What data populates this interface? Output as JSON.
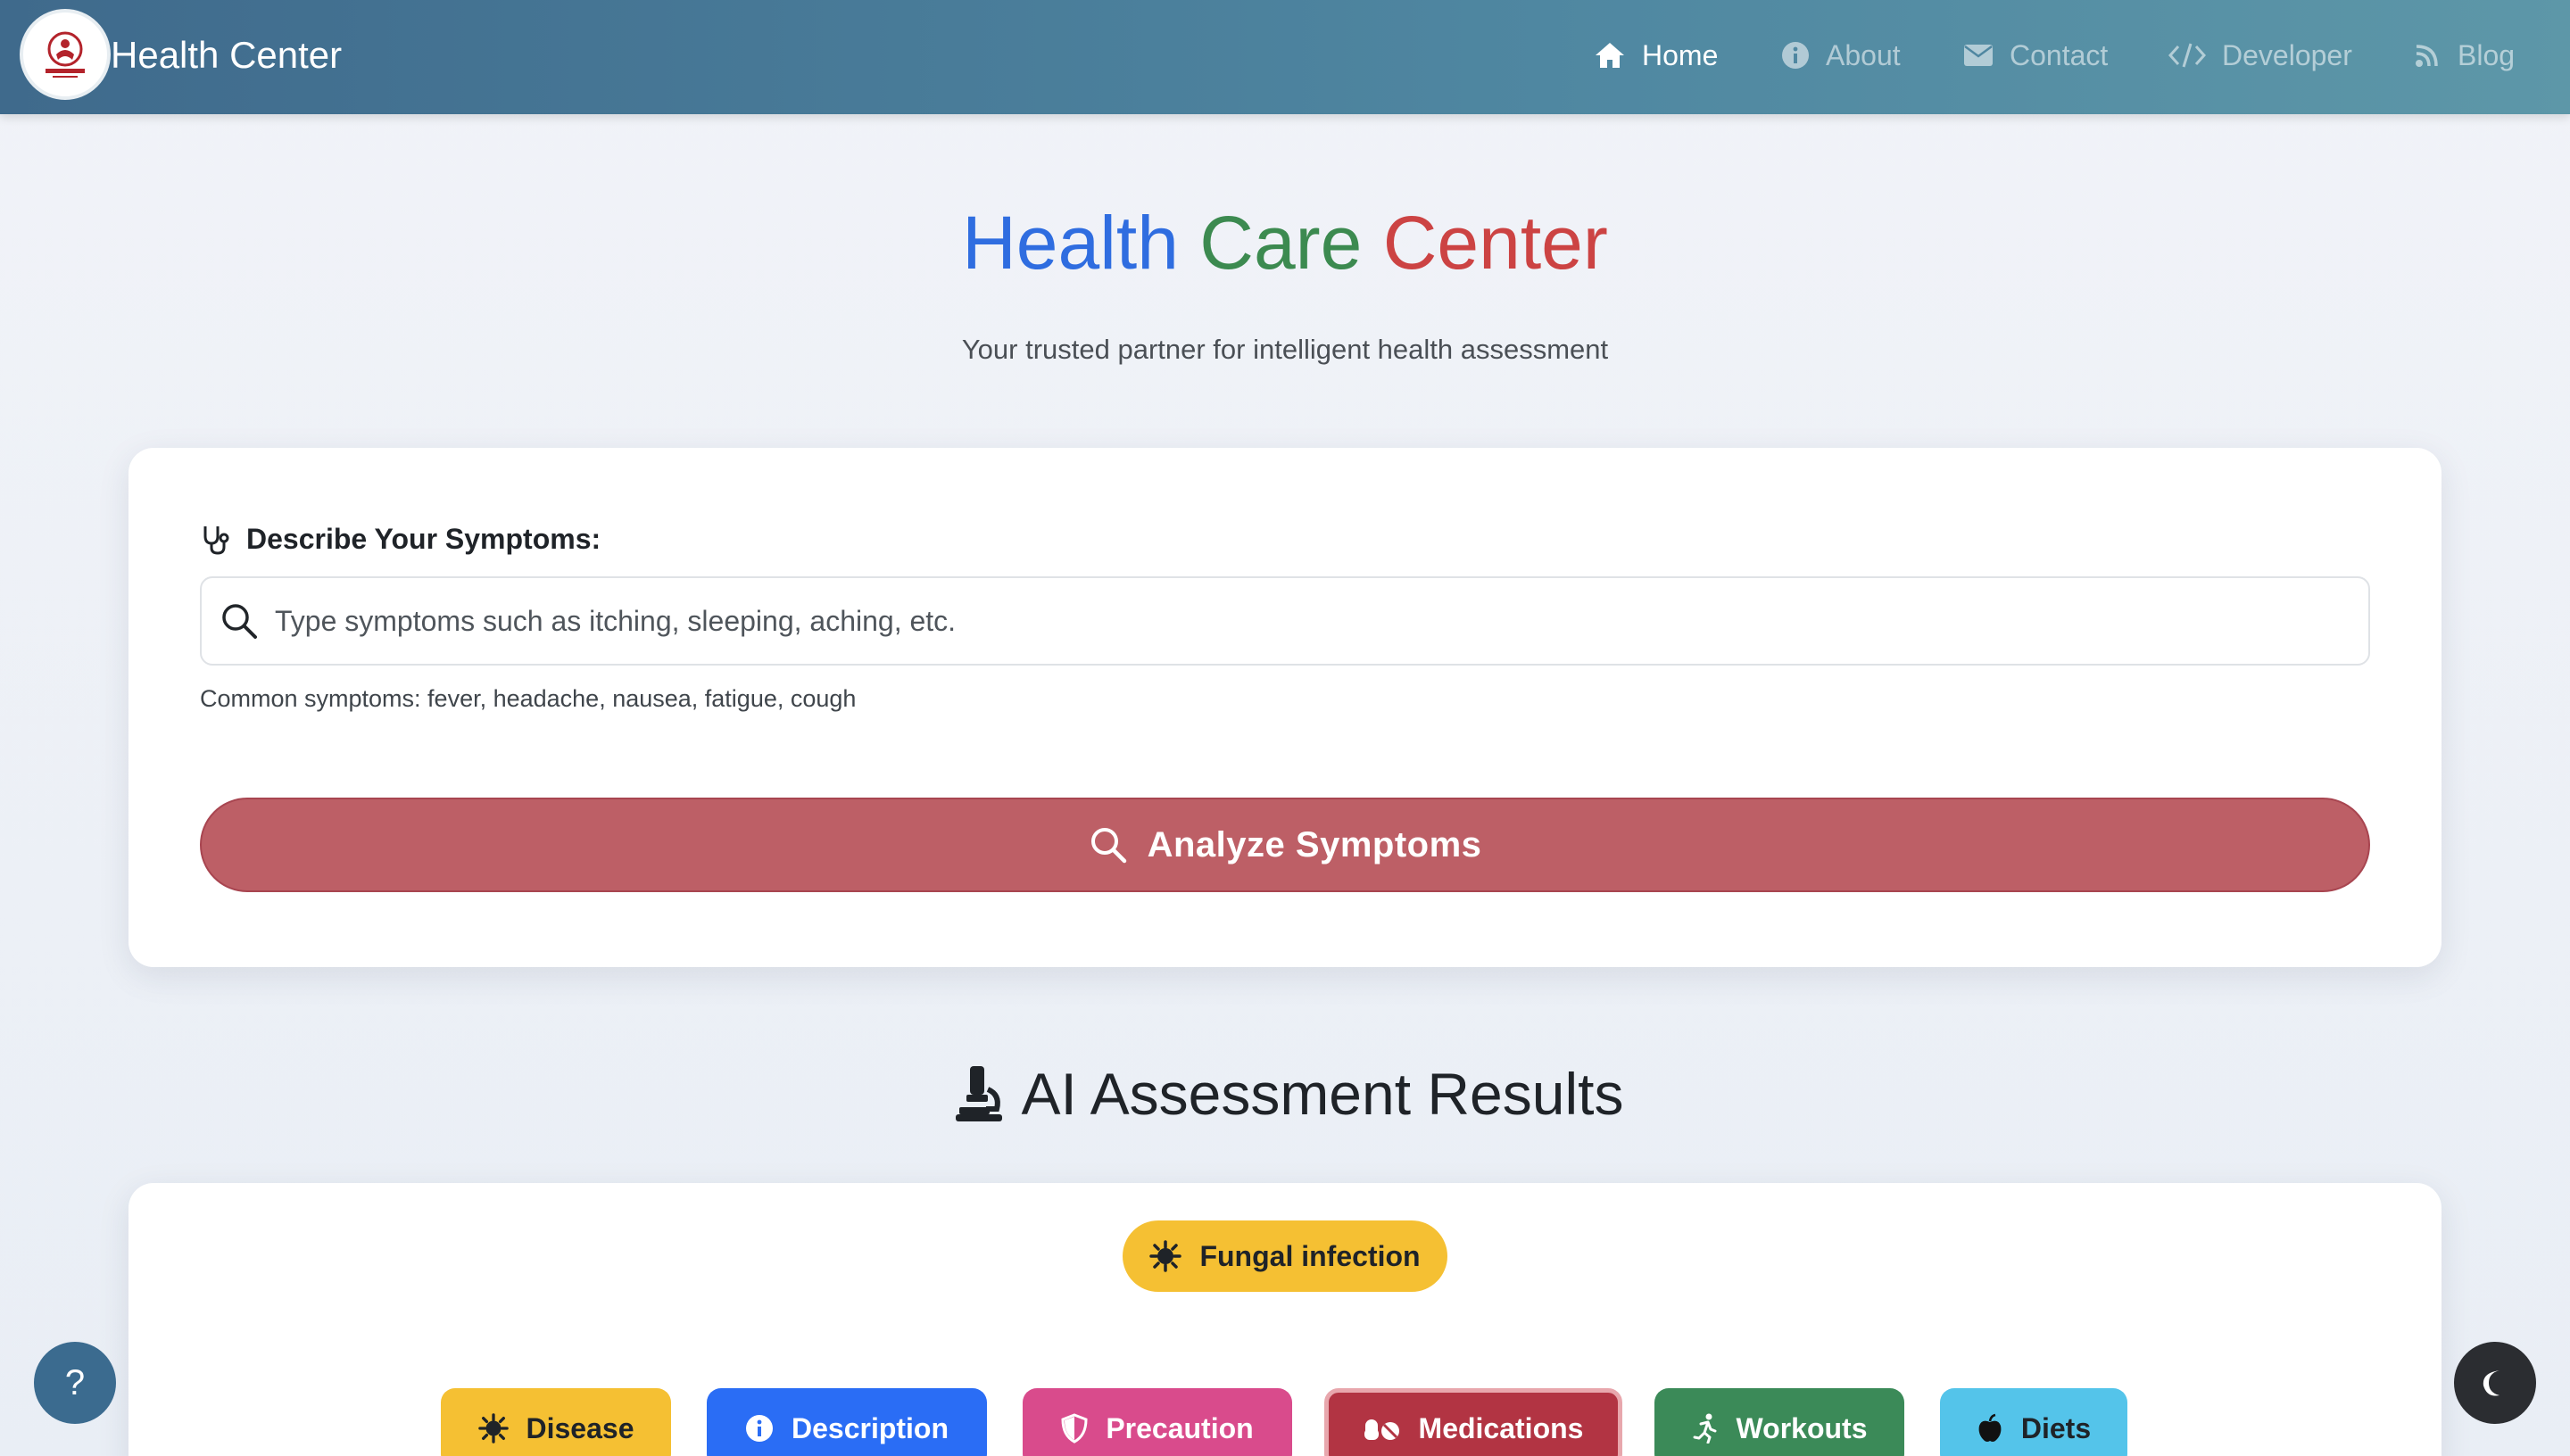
{
  "navbar": {
    "brand": "Health Center",
    "items": [
      {
        "label": "Home",
        "icon": "home-icon"
      },
      {
        "label": "About",
        "icon": "info-icon"
      },
      {
        "label": "Contact",
        "icon": "envelope-icon"
      },
      {
        "label": "Developer",
        "icon": "code-icon"
      },
      {
        "label": "Blog",
        "icon": "blog-icon"
      }
    ]
  },
  "header": {
    "title_part1": "Health",
    "title_part2": "Care",
    "title_part3": "Center",
    "subtitle": "Your trusted partner for intelligent health assessment"
  },
  "form": {
    "label": "Describe Your Symptoms:",
    "placeholder": "Type symptoms such as itching, sleeping, aching, etc.",
    "value": "",
    "hint": "Common symptoms: fever, headache, nausea, fatigue, cough",
    "submit_label": "Analyze Symptoms"
  },
  "results": {
    "title": "AI Assessment Results",
    "disease": "Fungal infection",
    "tabs": [
      {
        "label": "Disease",
        "color": "#f5c033"
      },
      {
        "label": "Description",
        "color": "#2a6df5"
      },
      {
        "label": "Precaution",
        "color": "#d94b8c"
      },
      {
        "label": "Medications",
        "color": "#b23443"
      },
      {
        "label": "Workouts",
        "color": "#3b8a58"
      },
      {
        "label": "Diets",
        "color": "#54c4ea"
      }
    ]
  },
  "help_button": "?",
  "colors": {
    "navbar": "#4a7d9a",
    "analyze_button": "#bd5f66",
    "title_blue": "#2f6de0",
    "title_green": "#3c8a50",
    "title_red": "#cc4343"
  }
}
